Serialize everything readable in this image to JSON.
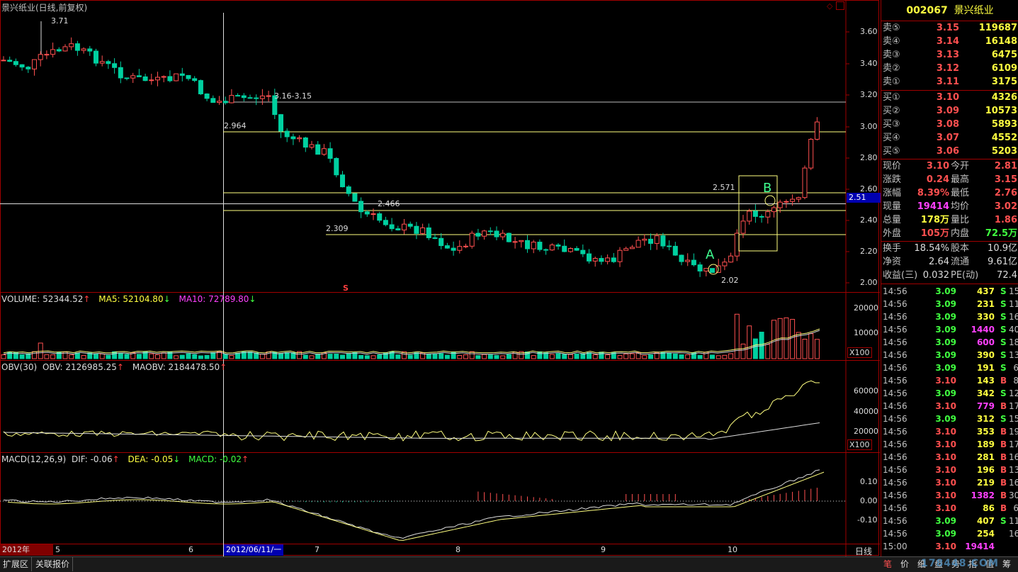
{
  "header": {
    "title": "景兴纸业(日线,前复权)"
  },
  "main_chart": {
    "price_labels": [
      "3.60",
      "3.40",
      "3.20",
      "3.00",
      "2.80",
      "2.60",
      "2.40",
      "2.20",
      "2.00"
    ],
    "high_marker": "3.71",
    "low_marker": "2.02",
    "range_label": "3.16-3.15",
    "level_labels": [
      "2.964",
      "2.466",
      "2.309",
      "2.571"
    ],
    "current_price_tag": "2.51",
    "annotation_a": "A",
    "annotation_b": "B",
    "signal_mark": "S"
  },
  "volume_panel": {
    "label": "VOLUME: 52344.52",
    "ma5": "MA5: 52104.80",
    "ma10": "MA10: 72789.80",
    "ticks": [
      "20000",
      "10000"
    ],
    "unit": "X100"
  },
  "obv_panel": {
    "label": "OBV(30)",
    "obv": "OBV: 2126985.25",
    "maobv": "MAOBV: 2184478.50",
    "ticks": [
      "60000",
      "40000",
      "20000"
    ],
    "unit": "X100"
  },
  "macd_panel": {
    "label": "MACD(12,26,9)",
    "dif": "DIF: -0.06",
    "dea": "DEA: -0.05",
    "macd": "MACD: -0.02",
    "ticks": [
      "0.10",
      "0.00",
      "-0.10"
    ]
  },
  "date_axis": {
    "year": "2012年",
    "months": [
      "5",
      "6",
      "7",
      "8",
      "9",
      "10"
    ],
    "cursor_date": "2012/06/11/一",
    "period": "日线"
  },
  "bottom_tabs": {
    "expand": "扩展区",
    "related": "关联报价"
  },
  "quote": {
    "code": "002067",
    "name": "景兴纸业",
    "asks": [
      {
        "label": "卖⑤",
        "price": "3.15",
        "vol": "119687"
      },
      {
        "label": "卖④",
        "price": "3.14",
        "vol": "16148"
      },
      {
        "label": "卖③",
        "price": "3.13",
        "vol": "6475"
      },
      {
        "label": "卖②",
        "price": "3.12",
        "vol": "6109"
      },
      {
        "label": "卖①",
        "price": "3.11",
        "vol": "3175"
      }
    ],
    "bids": [
      {
        "label": "买①",
        "price": "3.10",
        "vol": "4326"
      },
      {
        "label": "买②",
        "price": "3.09",
        "vol": "10573"
      },
      {
        "label": "买③",
        "price": "3.08",
        "vol": "5893"
      },
      {
        "label": "买④",
        "price": "3.07",
        "vol": "4552"
      },
      {
        "label": "买⑤",
        "price": "3.06",
        "vol": "5203"
      }
    ],
    "stats": [
      {
        "l1": "现价",
        "v1": "3.10",
        "c1": "#ff5050",
        "l2": "今开",
        "v2": "2.81",
        "c2": "#ff5050"
      },
      {
        "l1": "涨跌",
        "v1": "0.24",
        "c1": "#ff5050",
        "l2": "最高",
        "v2": "3.15",
        "c2": "#ff5050"
      },
      {
        "l1": "涨幅",
        "v1": "8.39%",
        "c1": "#ff5050",
        "l2": "最低",
        "v2": "2.76",
        "c2": "#ff5050"
      },
      {
        "l1": "现量",
        "v1": "19414",
        "c1": "#ff40ff",
        "l2": "均价",
        "v2": "3.02",
        "c2": "#ff5050"
      },
      {
        "l1": "总量",
        "v1": "178万",
        "c1": "#ffff40",
        "l2": "量比",
        "v2": "1.86",
        "c2": "#ff5050"
      },
      {
        "l1": "外盘",
        "v1": "105万",
        "c1": "#ff5050",
        "l2": "内盘",
        "v2": "72.5万",
        "c2": "#40ff40"
      }
    ],
    "fundamentals": [
      {
        "l1": "换手",
        "v1": "18.54%",
        "l2": "股本",
        "v2": "10.9亿"
      },
      {
        "l1": "净资",
        "v1": "2.64",
        "l2": "流通",
        "v2": "9.61亿"
      },
      {
        "l1": "收益(三)",
        "v1": "0.032",
        "l2": "PE(动)",
        "v2": "72.4"
      }
    ],
    "ticks": [
      {
        "t": "14:56",
        "p": "3.09",
        "v": "437",
        "s": "S",
        "n": "15"
      },
      {
        "t": "14:56",
        "p": "3.09",
        "v": "231",
        "s": "S",
        "n": "11"
      },
      {
        "t": "14:56",
        "p": "3.09",
        "v": "330",
        "s": "S",
        "n": "16"
      },
      {
        "t": "14:56",
        "p": "3.09",
        "v": "1440",
        "s": "S",
        "n": "40"
      },
      {
        "t": "14:56",
        "p": "3.09",
        "v": "600",
        "s": "S",
        "n": "18"
      },
      {
        "t": "14:56",
        "p": "3.09",
        "v": "390",
        "s": "S",
        "n": "13"
      },
      {
        "t": "14:56",
        "p": "3.09",
        "v": "191",
        "s": "S",
        "n": "6"
      },
      {
        "t": "14:56",
        "p": "3.10",
        "v": "143",
        "s": "B",
        "n": "8"
      },
      {
        "t": "14:56",
        "p": "3.09",
        "v": "342",
        "s": "S",
        "n": "12"
      },
      {
        "t": "14:56",
        "p": "3.10",
        "v": "779",
        "s": "B",
        "n": "17"
      },
      {
        "t": "14:56",
        "p": "3.09",
        "v": "312",
        "s": "S",
        "n": "15"
      },
      {
        "t": "14:56",
        "p": "3.10",
        "v": "353",
        "s": "B",
        "n": "19"
      },
      {
        "t": "14:56",
        "p": "3.10",
        "v": "189",
        "s": "B",
        "n": "17"
      },
      {
        "t": "14:56",
        "p": "3.10",
        "v": "281",
        "s": "B",
        "n": "16"
      },
      {
        "t": "14:56",
        "p": "3.10",
        "v": "196",
        "s": "B",
        "n": "13"
      },
      {
        "t": "14:56",
        "p": "3.10",
        "v": "219",
        "s": "B",
        "n": "16"
      },
      {
        "t": "14:56",
        "p": "3.10",
        "v": "1382",
        "s": "B",
        "n": "30"
      },
      {
        "t": "14:56",
        "p": "3.10",
        "v": "86",
        "s": "B",
        "n": "6"
      },
      {
        "t": "14:56",
        "p": "3.09",
        "v": "407",
        "s": "S",
        "n": "11"
      },
      {
        "t": "14:56",
        "p": "3.09",
        "v": "254",
        "s": "",
        "n": "16"
      },
      {
        "t": "15:00",
        "p": "3.10",
        "v": "19414",
        "s": "",
        "n": ""
      }
    ],
    "bottom_tabs": [
      "笔",
      "价",
      "细",
      "盘",
      "势",
      "指",
      "值",
      "筹"
    ],
    "watermark": "178448.COM"
  },
  "chart_data": {
    "type": "candlestick",
    "series": [
      {
        "name": "DIF"
      },
      {
        "name": "DEA"
      }
    ]
  }
}
